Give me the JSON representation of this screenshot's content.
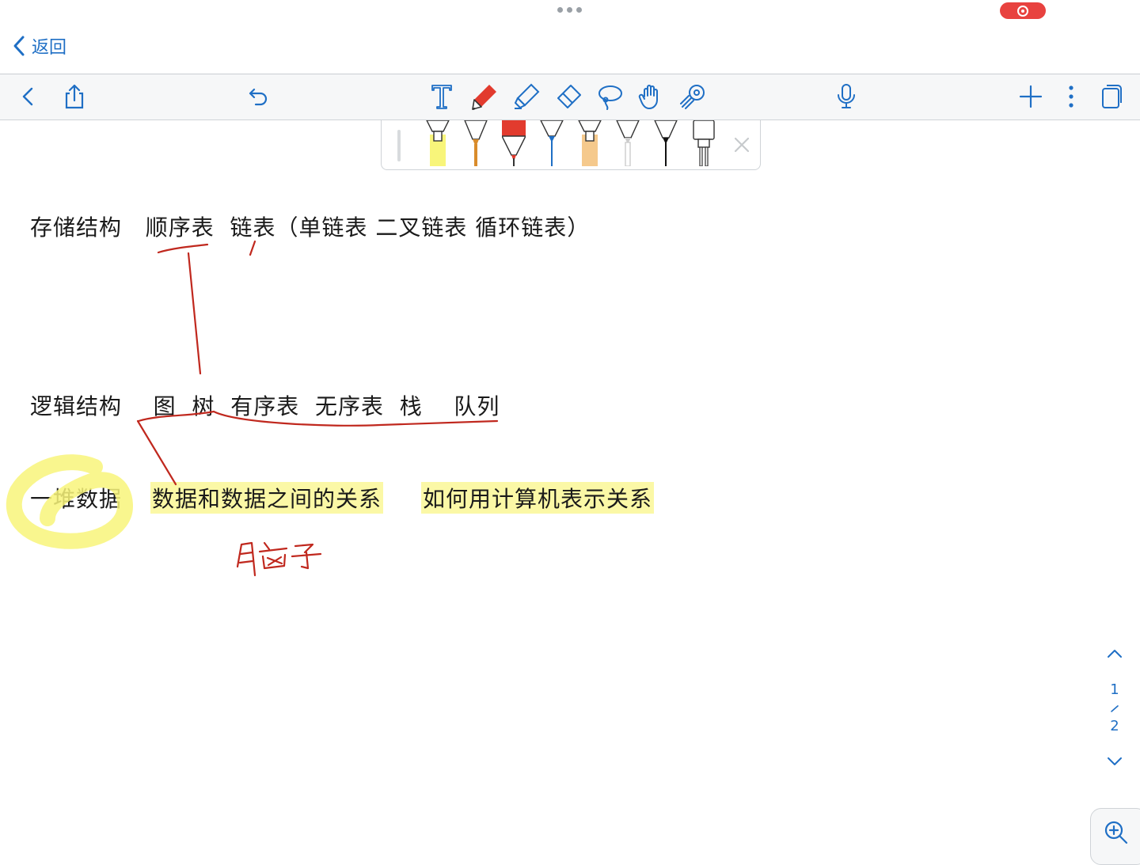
{
  "nav": {
    "back_label": "返回"
  },
  "toolbar": {
    "icons": [
      "chevron-left-icon",
      "share-icon",
      "undo-icon",
      "text-tool-icon",
      "pen-tool-icon",
      "highlighter-tool-icon",
      "eraser-tool-icon",
      "lasso-tool-icon",
      "hand-tool-icon",
      "laser-pointer-icon",
      "microphone-icon",
      "add-icon",
      "more-icon",
      "pages-icon"
    ]
  },
  "pens": {
    "colors": [
      "#f8f57a",
      "#d98c2b",
      "#e23b2e",
      "#1f6fc5",
      "#f5c98c",
      "#cccccc",
      "#111111",
      "#ffffff"
    ]
  },
  "notes": {
    "line1": "存储结构   顺序表  链表（单链表 二叉链表 循环链表）",
    "line2": "逻辑结构    图  树  有序表  无序表  栈    队列",
    "line3_a": "一堆数据",
    "line3_b": "数据和数据之间的关系",
    "line3_c": "如何用计算机表示关系",
    "handwritten": "脑子"
  },
  "pager": {
    "current": "1",
    "total": "2"
  },
  "colors": {
    "accent": "#1f6fc5",
    "ink_red": "#c0281e",
    "highlight": "#fbf8a6"
  }
}
